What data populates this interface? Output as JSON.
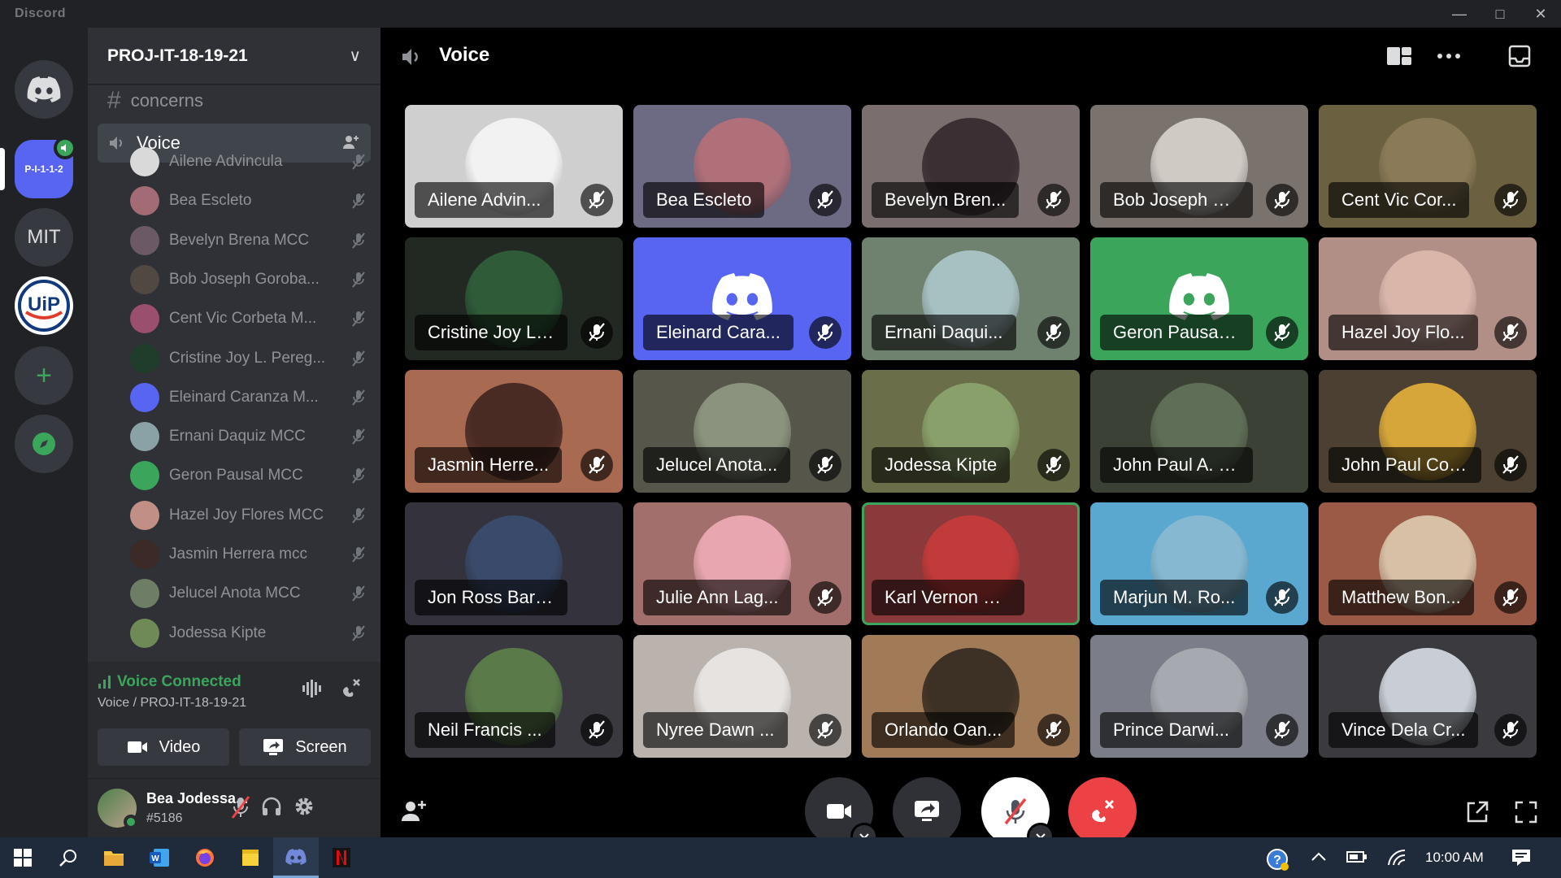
{
  "app": {
    "title": "Discord"
  },
  "window_controls": [
    "minimize",
    "maximize",
    "close"
  ],
  "guilds": {
    "active_label": "P-I-1-1-2",
    "mit_label": "MIT",
    "uip_label": "UiP",
    "add_label": "+"
  },
  "server": {
    "name": "PROJ-IT-18-19-21"
  },
  "channels": {
    "text_channel": "concerns",
    "voice_channel": "Voice"
  },
  "voice_members": [
    {
      "name": "Ailene Advincula",
      "color": "#d9d9d9"
    },
    {
      "name": "Bea Escleto",
      "color": "#a36b74"
    },
    {
      "name": "Bevelyn Brena MCC",
      "color": "#6b5a66"
    },
    {
      "name": "Bob Joseph Goroba...",
      "color": "#514842"
    },
    {
      "name": "Cent Vic Corbeta M...",
      "color": "#9a4f6e"
    },
    {
      "name": "Cristine Joy L. Pereg...",
      "color": "#1f3d2a"
    },
    {
      "name": "Eleinard Caranza M...",
      "color": "#5865f2"
    },
    {
      "name": "Ernani Daquiz MCC",
      "color": "#8aa1a6"
    },
    {
      "name": "Geron Pausal MCC",
      "color": "#3ba55c"
    },
    {
      "name": "Hazel Joy Flores MCC",
      "color": "#c28f86"
    },
    {
      "name": "Jasmin Herrera mcc",
      "color": "#3b2a25"
    },
    {
      "name": "Jelucel Anota MCC",
      "color": "#6e7d66"
    },
    {
      "name": "Jodessa Kipte",
      "color": "#6f8a57"
    }
  ],
  "rtc": {
    "status": "Voice Connected",
    "location": "Voice / PROJ-IT-18-19-21",
    "video_label": "Video",
    "screen_label": "Screen"
  },
  "user": {
    "name": "Bea Jodessa...",
    "tag": "#5186"
  },
  "call": {
    "title": "Voice"
  },
  "tiles": [
    {
      "name": "Ailene Advin...",
      "bg": "#cfcfcf",
      "av": "#f2f2f2",
      "muted": true
    },
    {
      "name": "Bea Escleto",
      "bg": "#6d6a84",
      "av": "#b0707a",
      "muted": true
    },
    {
      "name": "Bevelyn Bren...",
      "bg": "#7b6e6f",
      "av": "#3c2f33",
      "muted": true
    },
    {
      "name": "Bob Joseph G...",
      "bg": "#7a726c",
      "av": "#cfcac4",
      "muted": true
    },
    {
      "name": "Cent Vic Cor...",
      "bg": "#6b6141",
      "av": "#8a7a57",
      "muted": true
    },
    {
      "name": "Cristine Joy L....",
      "bg": "#222922",
      "av": "#2f5b39",
      "muted": true
    },
    {
      "name": "Eleinard Cara...",
      "bg": "#5865f2",
      "av": "",
      "muted": true,
      "discord": true
    },
    {
      "name": "Ernani Daqui...",
      "bg": "#6f8270",
      "av": "#a7c0c2",
      "muted": true
    },
    {
      "name": "Geron Pausal ...",
      "bg": "#3ba55c",
      "av": "",
      "muted": true,
      "discord": true
    },
    {
      "name": "Hazel Joy Flo...",
      "bg": "#b18f86",
      "av": "#d9b5aa",
      "muted": true
    },
    {
      "name": "Jasmin Herre...",
      "bg": "#a96a52",
      "av": "#4a2b24",
      "muted": true
    },
    {
      "name": "Jelucel Anota...",
      "bg": "#56574a",
      "av": "#8b937e",
      "muted": true
    },
    {
      "name": "Jodessa Kipte",
      "bg": "#6a6f49",
      "av": "#8aa06a",
      "muted": true
    },
    {
      "name": "John Paul A. Nofu...",
      "bg": "#3b4235",
      "av": "#5f6e57",
      "muted": false
    },
    {
      "name": "John Paul Cor...",
      "bg": "#4b4031",
      "av": "#d6a63a",
      "muted": true
    },
    {
      "name": "Jon Ross Barretto",
      "bg": "#33323d",
      "av": "#3a4a6a",
      "muted": false
    },
    {
      "name": "Julie Ann Lag...",
      "bg": "#a26f6c",
      "av": "#e8a7b0",
      "muted": true
    },
    {
      "name": "Karl Vernon Balto...",
      "bg": "#8a3a3a",
      "av": "#c23b3b",
      "muted": false,
      "speaking": true
    },
    {
      "name": "Marjun M. Ro...",
      "bg": "#5aa7cf",
      "av": "#86b8d1",
      "muted": true
    },
    {
      "name": "Matthew Bon...",
      "bg": "#9a5a45",
      "av": "#d8c0a6",
      "muted": true
    },
    {
      "name": "Neil Francis ...",
      "bg": "#3a3940",
      "av": "#5a7a4a",
      "muted": true
    },
    {
      "name": "Nyree Dawn ...",
      "bg": "#b9b2ad",
      "av": "#e7e3e0",
      "muted": true
    },
    {
      "name": "Orlando Oan...",
      "bg": "#a17a57",
      "av": "#3d3024",
      "muted": true
    },
    {
      "name": "Prince Darwi...",
      "bg": "#7b7e88",
      "av": "#a7a9b0",
      "muted": true
    },
    {
      "name": "Vince Dela Cr...",
      "bg": "#3b3b3f",
      "av": "#c9ced6",
      "muted": true
    }
  ],
  "taskbar": {
    "apps": [
      "start",
      "search",
      "file-explorer",
      "word",
      "firefox",
      "sticky-notes",
      "discord",
      "netflix"
    ],
    "time": "10:00 AM"
  }
}
